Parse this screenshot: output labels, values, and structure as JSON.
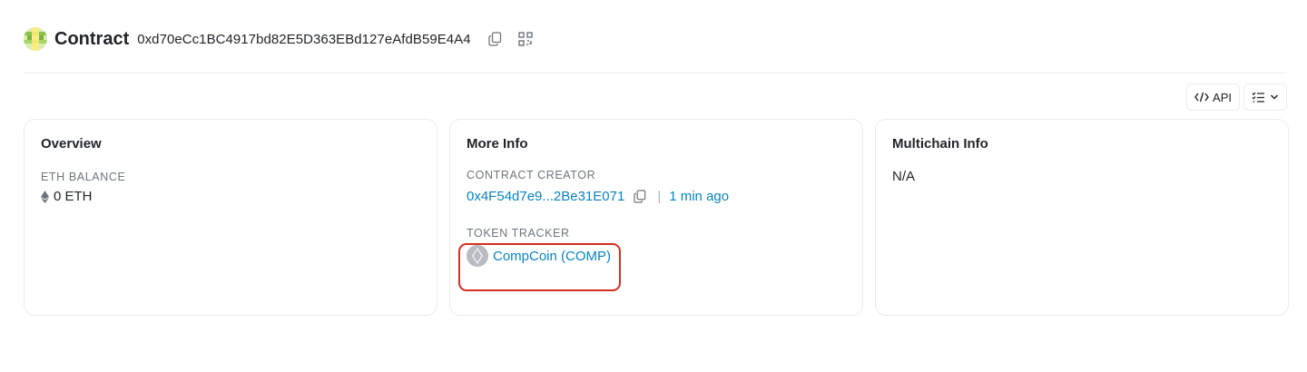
{
  "header": {
    "title": "Contract",
    "address": "0xd70eCc1BC4917bd82E5D363EBd127eAfdB59E4A4",
    "icons": [
      "copy-icon",
      "qr-code-icon"
    ]
  },
  "toolbar": {
    "api_label": "API",
    "api_icon": "code-icon",
    "menu_icon": "list-check-icon"
  },
  "overview": {
    "title": "Overview",
    "balance_label": "ETH BALANCE",
    "balance_value": "0 ETH"
  },
  "more_info": {
    "title": "More Info",
    "creator_label": "CONTRACT CREATOR",
    "creator_address": "0x4F54d7e9...2Be31E071",
    "creator_separator": "|",
    "creator_time": "1 min ago",
    "token_label": "TOKEN TRACKER",
    "token_name": "CompCoin (COMP)"
  },
  "multichain": {
    "title": "Multichain Info",
    "value": "N/A"
  },
  "colors": {
    "link": "#0784c3",
    "highlight_border": "#d3301f",
    "border": "#e9ecef",
    "muted": "#6c757d"
  }
}
